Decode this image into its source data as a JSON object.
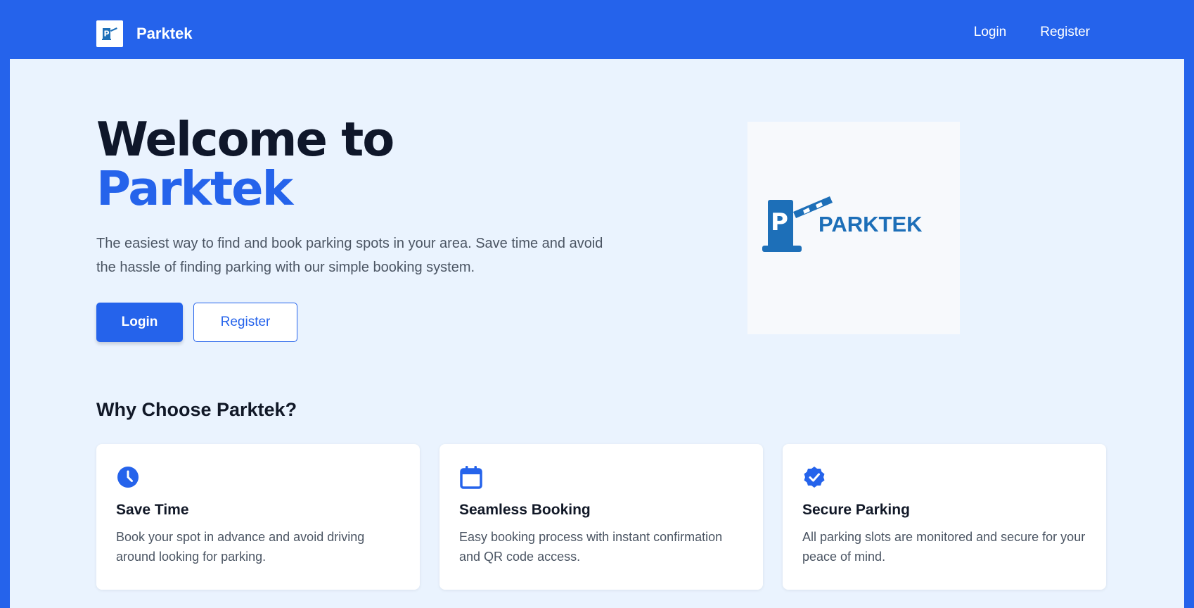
{
  "navbar": {
    "brand_name": "Parktek",
    "links": [
      {
        "label": "Login"
      },
      {
        "label": "Register"
      }
    ]
  },
  "hero": {
    "title_line1": "Welcome to",
    "title_line2": "Parktek",
    "description": "The easiest way to find and book parking spots in your area. Save time and avoid the hassle of finding parking with our simple booking system.",
    "login_button": "Login",
    "register_button": "Register",
    "logo_text": "PARKTEK"
  },
  "features": {
    "title": "Why Choose Parktek?",
    "cards": [
      {
        "icon": "clock-icon",
        "title": "Save Time",
        "text": "Book your spot in advance and avoid driving around looking for parking."
      },
      {
        "icon": "calendar-icon",
        "title": "Seamless Booking",
        "text": "Easy booking process with instant confirmation and QR code access."
      },
      {
        "icon": "shield-check-icon",
        "title": "Secure Parking",
        "text": "All parking slots are monitored and secure for your peace of mind."
      }
    ]
  },
  "colors": {
    "primary": "#2563eb",
    "page_background": "#eaf3fe",
    "logo_blue": "#1d6fb8"
  }
}
